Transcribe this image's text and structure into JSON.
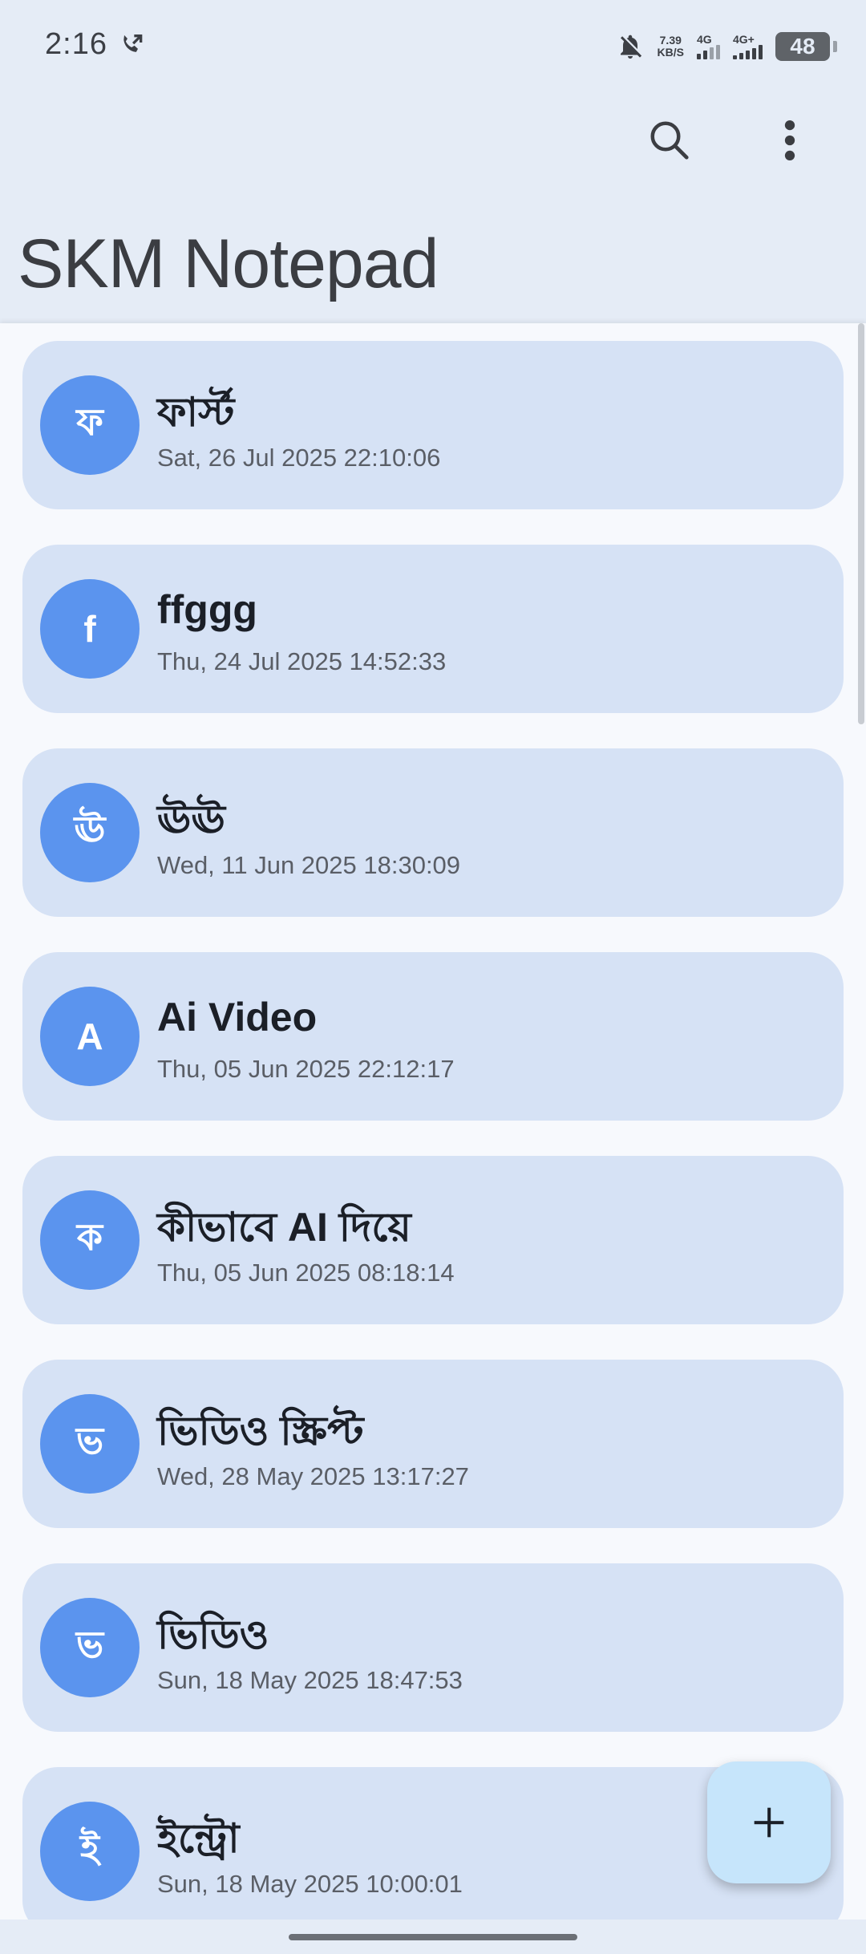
{
  "status_bar": {
    "time": "2:16",
    "net_speed_value": "7.39",
    "net_speed_unit": "KB/S",
    "sim1_label": "4G",
    "sim2_label": "4G+",
    "battery": "48"
  },
  "app_bar": {
    "title": "SKM Notepad",
    "search_icon": "search-icon",
    "more_icon": "more-vert-icon"
  },
  "notes": [
    {
      "initial": "ফ",
      "title": "ফার্স্ট",
      "date": "Sat, 26 Jul 2025 22:10:06"
    },
    {
      "initial": "f",
      "title": "ffggg",
      "date": "Thu, 24 Jul 2025 14:52:33"
    },
    {
      "initial": "ঊ",
      "title": "ঊঊ",
      "date": "Wed, 11 Jun 2025 18:30:09"
    },
    {
      "initial": "A",
      "title": "Ai Video",
      "date": "Thu, 05 Jun 2025 22:12:17"
    },
    {
      "initial": "ক",
      "title": "কীভাবে AI দিয়ে",
      "date": "Thu, 05 Jun 2025 08:18:14"
    },
    {
      "initial": "ভ",
      "title": "ভিডিও স্ক্রিপ্ট",
      "date": "Wed, 28 May 2025 13:17:27"
    },
    {
      "initial": "ভ",
      "title": "ভিডিও",
      "date": "Sun, 18 May 2025 18:47:53"
    },
    {
      "initial": "ই",
      "title": "ইন্ট্রো",
      "date": "Sun, 18 May 2025 10:00:01"
    }
  ],
  "fab": {
    "icon": "plus-icon"
  },
  "colors": {
    "background": "#e5ecf6",
    "card": "#d6e2f5",
    "avatar": "#5b94ee",
    "fab": "#c6e5fb"
  }
}
